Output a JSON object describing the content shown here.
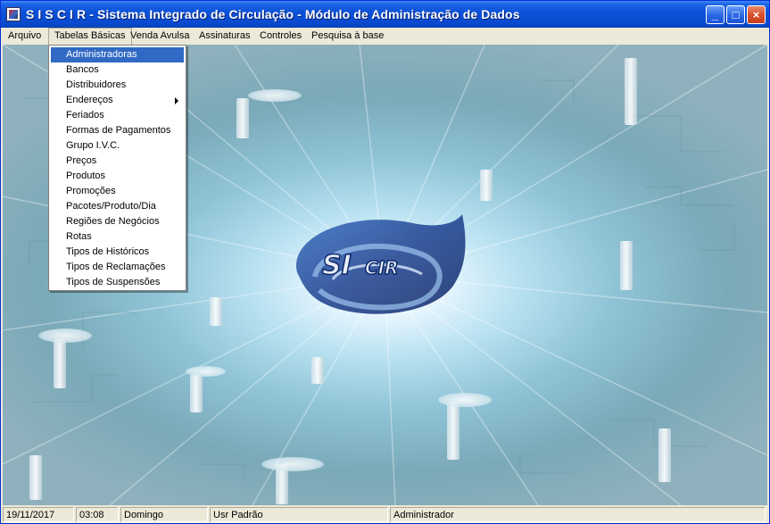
{
  "window": {
    "title": "S I S C I R - Sistema Integrado de Circulação - Módulo de Administração de Dados",
    "controls": {
      "minimize": "_",
      "maximize": "□",
      "close": "×"
    }
  },
  "menubar": {
    "items": [
      {
        "label": "Arquivo"
      },
      {
        "label": "Tabelas Básicas",
        "open": true
      },
      {
        "label": "Venda Avulsa"
      },
      {
        "label": "Assinaturas"
      },
      {
        "label": "Controles"
      },
      {
        "label": "Pesquisa à base"
      }
    ]
  },
  "dropdown": {
    "items": [
      {
        "label": "Administradoras",
        "highlighted": true
      },
      {
        "label": "Bancos"
      },
      {
        "label": "Distribuidores"
      },
      {
        "label": "Endereços",
        "submenu": true
      },
      {
        "label": "Feriados"
      },
      {
        "label": "Formas de Pagamentos"
      },
      {
        "label": "Grupo I.V.C."
      },
      {
        "label": "Preços"
      },
      {
        "label": "Produtos"
      },
      {
        "label": "Promoções"
      },
      {
        "label": "Pacotes/Produto/Dia"
      },
      {
        "label": "Regiões de Negócios"
      },
      {
        "label": "Rotas"
      },
      {
        "label": "Tipos de Históricos"
      },
      {
        "label": "Tipos de Reclamações"
      },
      {
        "label": "Tipos de Suspensões"
      }
    ]
  },
  "logo": {
    "text_main": "SI",
    "text_small": "CIR"
  },
  "statusbar": {
    "date": "19/11/2017",
    "time": "03:08",
    "weekday": "Domingo",
    "user_profile": "Usr Padrão",
    "user_name": "Administrador"
  },
  "colors": {
    "titlebar": "#0b51d8",
    "menu_highlight": "#316ac5",
    "frame": "#ece9d8"
  }
}
